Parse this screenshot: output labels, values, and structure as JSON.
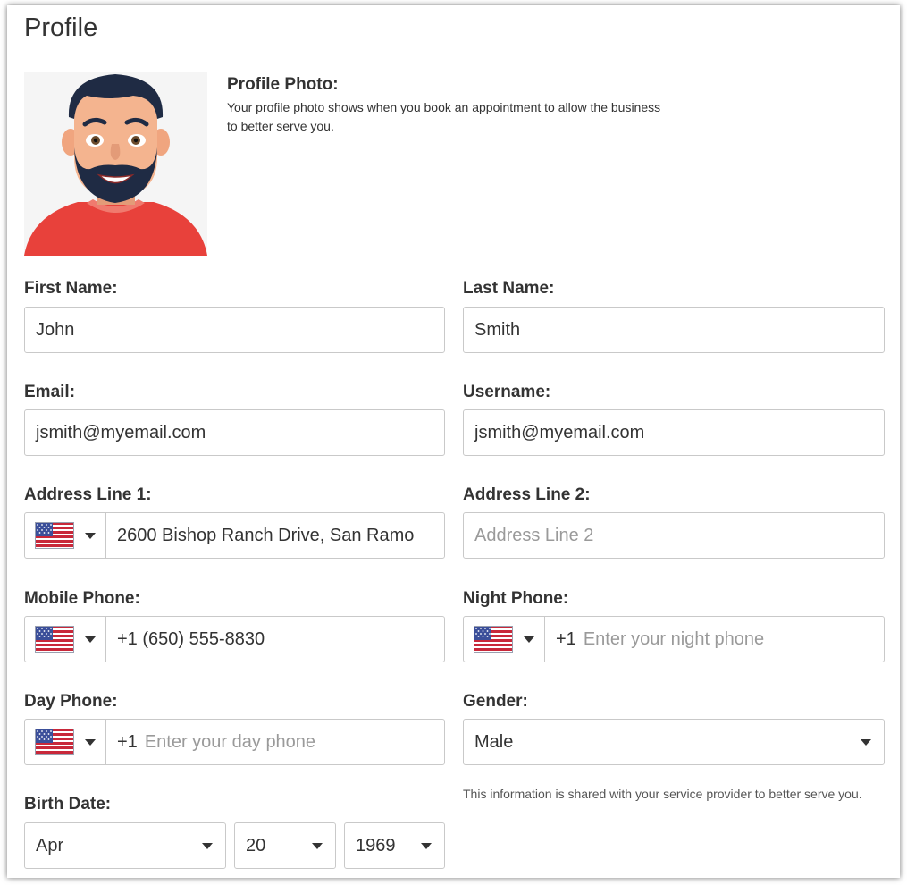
{
  "page": {
    "title": "Profile"
  },
  "profile_photo": {
    "heading": "Profile Photo:",
    "description": "Your profile photo shows when you book an appointment to allow the business to better serve you."
  },
  "first_name": {
    "label": "First Name:",
    "value": "John"
  },
  "last_name": {
    "label": "Last Name:",
    "value": "Smith"
  },
  "email": {
    "label": "Email:",
    "value": "jsmith@myemail.com"
  },
  "username": {
    "label": "Username:",
    "value": "jsmith@myemail.com"
  },
  "address1": {
    "label": "Address Line 1:",
    "value": "2600 Bishop Ranch Drive, San Ramo",
    "country_icon": "us-flag-icon"
  },
  "address2": {
    "label": "Address Line 2:",
    "placeholder": "Address Line 2"
  },
  "mobile_phone": {
    "label": "Mobile Phone:",
    "value": "+1 (650) 555-8830",
    "country_icon": "us-flag-icon"
  },
  "night_phone": {
    "label": "Night Phone:",
    "prefix": "+1",
    "placeholder": "Enter your night phone",
    "country_icon": "us-flag-icon"
  },
  "day_phone": {
    "label": "Day Phone:",
    "prefix": "+1",
    "placeholder": "Enter your day phone",
    "country_icon": "us-flag-icon"
  },
  "gender": {
    "label": "Gender:",
    "value": "Male",
    "note": "This information is shared with your service provider to better serve you."
  },
  "birth_date": {
    "label": "Birth Date:",
    "month": "Apr",
    "day": "20",
    "year": "1969"
  },
  "colors": {
    "border": "#c9c9c9",
    "text": "#333333",
    "placeholder": "#9a9a9a",
    "avatar_shirt": "#e8413b",
    "avatar_hair": "#1f2b44",
    "avatar_skin": "#f4b48f"
  }
}
